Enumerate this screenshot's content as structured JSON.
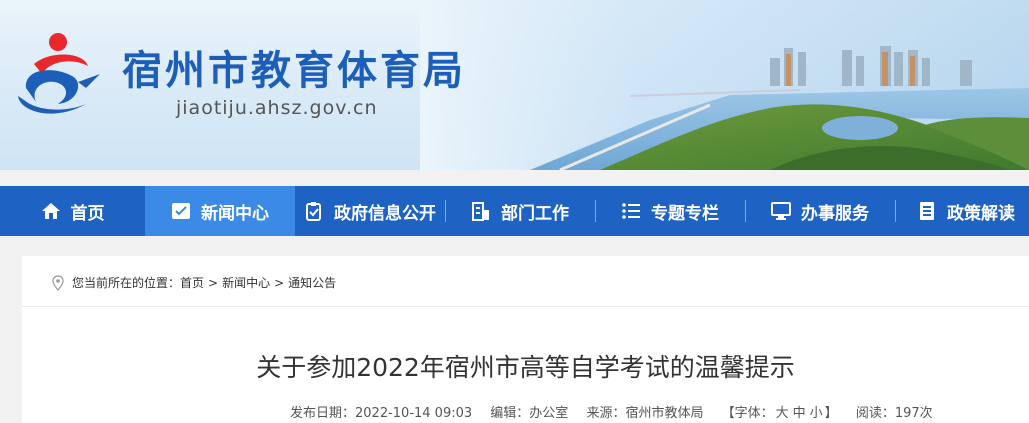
{
  "header": {
    "site_title": "宿州市教育体育局",
    "site_domain": "jiaotiju.ahsz.gov.cn"
  },
  "nav": {
    "items": [
      {
        "label": "首页",
        "icon": "home-icon"
      },
      {
        "label": "新闻中心",
        "icon": "news-icon",
        "active": true
      },
      {
        "label": "政府信息公开",
        "icon": "clipboard-check-icon"
      },
      {
        "label": "部门工作",
        "icon": "building-icon"
      },
      {
        "label": "专题专栏",
        "icon": "list-icon"
      },
      {
        "label": "办事服务",
        "icon": "monitor-icon"
      },
      {
        "label": "政策解读",
        "icon": "document-icon"
      }
    ]
  },
  "breadcrumb": {
    "prefix": "您当前所在的位置：",
    "items": [
      "首页",
      "新闻中心",
      "通知公告"
    ],
    "separator": ">"
  },
  "article": {
    "title": "关于参加2022年宿州市高等自学考试的温馨提示",
    "publish_date": "发布日期：2022-10-14 09:03",
    "editor": "编辑：办公室",
    "source": "来源：宿州市教体局",
    "font_label_open": "【字体：",
    "font_sizes": [
      "大",
      "中",
      "小"
    ],
    "font_label_close": "】",
    "views": "阅读：197次"
  },
  "colors": {
    "nav_bg": "#1e63c3",
    "nav_active": "#3a8ae6",
    "title_blue": "#1d5fb8"
  }
}
